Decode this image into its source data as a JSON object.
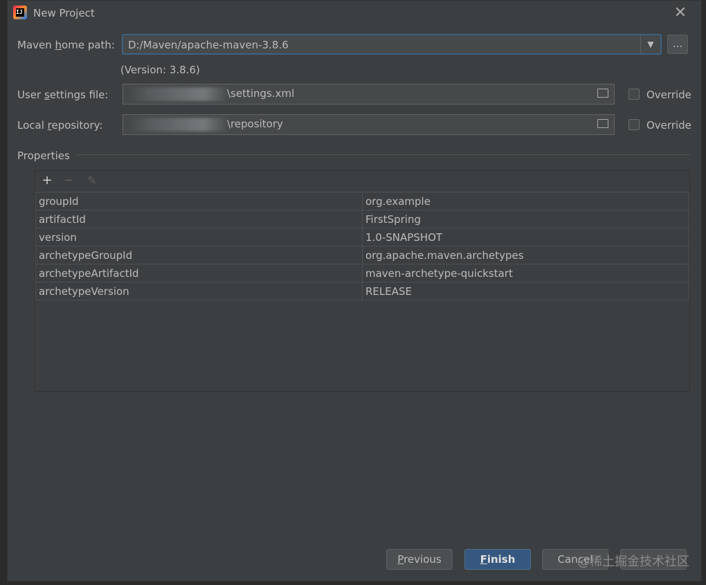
{
  "window": {
    "title": "New Project",
    "app_icon_text": "IJ",
    "close_glyph": "✕"
  },
  "maven": {
    "home_label_pre": "Maven ",
    "home_label_u": "h",
    "home_label_post": "ome path:",
    "home_value": "D:/Maven/apache-maven-3.8.6",
    "browse_label": "...",
    "version_text": "(Version: 3.8.6)",
    "settings_label_pre": "User ",
    "settings_label_u": "s",
    "settings_label_post": "ettings file:",
    "settings_value": "\\settings.xml",
    "repo_label_pre": "Local ",
    "repo_label_u": "r",
    "repo_label_post": "epository:",
    "repo_value": "\\repository",
    "override_label": "Override"
  },
  "properties": {
    "section_label": "Properties",
    "toolbar": {
      "add": "+",
      "remove": "−",
      "edit": "✎"
    },
    "rows": [
      {
        "key": "groupId",
        "value": "org.example"
      },
      {
        "key": "artifactId",
        "value": "FirstSpring"
      },
      {
        "key": "version",
        "value": "1.0-SNAPSHOT"
      },
      {
        "key": "archetypeGroupId",
        "value": "org.apache.maven.archetypes"
      },
      {
        "key": "archetypeArtifactId",
        "value": "maven-archetype-quickstart"
      },
      {
        "key": "archetypeVersion",
        "value": "RELEASE"
      }
    ]
  },
  "buttons": {
    "previous_u": "P",
    "previous_rest": "revious",
    "finish_u": "F",
    "finish_rest": "inish",
    "cancel": "Cancel"
  },
  "watermark": "@稀土掘金技术社区",
  "colors": {
    "window_bg": "#3c3f41",
    "field_bg": "#45494a",
    "primary_button": "#365880",
    "focus_border": "#3d6185"
  }
}
